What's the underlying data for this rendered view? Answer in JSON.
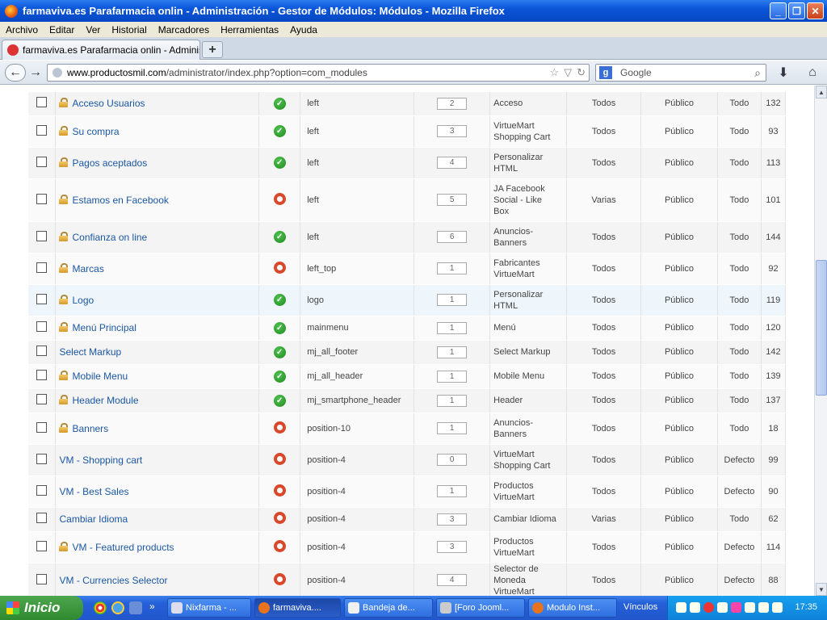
{
  "window": {
    "title": "farmaviva.es Parafarmacia onlin - Administración - Gestor de Módulos: Módulos - Mozilla Firefox",
    "minimize": "_",
    "maximize": "❐",
    "close": "✕"
  },
  "menu": [
    "Archivo",
    "Editar",
    "Ver",
    "Historial",
    "Marcadores",
    "Herramientas",
    "Ayuda"
  ],
  "tab": {
    "title": "farmaviva.es Parafarmacia onlin - Administra...",
    "new_tab": "+"
  },
  "nav": {
    "url_host": "www.productosmil.com",
    "url_path": "/administrator/index.php?option=com_modules",
    "search_placeholder": "Google",
    "search_engine": "g",
    "back": "←",
    "forward": "→",
    "star": "☆",
    "dropdown": "▽",
    "reload": "↻",
    "search_btn": "⌕",
    "download": "⬇",
    "home": "⌂"
  },
  "status_icons": {
    "published": "✓"
  },
  "modules": [
    {
      "locked": true,
      "title": "Acceso Usuarios",
      "published": true,
      "position": "left",
      "order": "2",
      "type": [
        "Acceso"
      ],
      "pages": "Todos",
      "access": "Público",
      "language": "Todo",
      "id": "132"
    },
    {
      "locked": true,
      "title": "Su compra",
      "published": true,
      "position": "left",
      "order": "3",
      "type": [
        "VirtueMart",
        "Shopping Cart"
      ],
      "pages": "Todos",
      "access": "Público",
      "language": "Todo",
      "id": "93"
    },
    {
      "locked": true,
      "title": "Pagos aceptados",
      "published": true,
      "position": "left",
      "order": "4",
      "type": [
        "Personalizar",
        "HTML"
      ],
      "pages": "Todos",
      "access": "Público",
      "language": "Todo",
      "id": "113"
    },
    {
      "locked": true,
      "title": "Estamos en Facebook",
      "published": false,
      "position": "left",
      "order": "5",
      "type": [
        "JA Facebook",
        "Social - Like",
        "Box"
      ],
      "pages": "Varias",
      "access": "Público",
      "language": "Todo",
      "id": "101"
    },
    {
      "locked": true,
      "title": "Confianza on line",
      "published": true,
      "position": "left",
      "order": "6",
      "type": [
        "Anuncios-",
        "Banners"
      ],
      "pages": "Todos",
      "access": "Público",
      "language": "Todo",
      "id": "144"
    },
    {
      "locked": true,
      "title": "Marcas",
      "published": false,
      "position": "left_top",
      "order": "1",
      "type": [
        "Fabricantes",
        "VirtueMart"
      ],
      "pages": "Todos",
      "access": "Público",
      "language": "Todo",
      "id": "92"
    },
    {
      "locked": true,
      "title": "Logo",
      "published": true,
      "position": "logo",
      "order": "1",
      "type": [
        "Personalizar",
        "HTML"
      ],
      "pages": "Todos",
      "access": "Público",
      "language": "Todo",
      "id": "119",
      "highlight": true
    },
    {
      "locked": true,
      "title": "Menú Principal",
      "published": true,
      "position": "mainmenu",
      "order": "1",
      "type": [
        "Menú"
      ],
      "pages": "Todos",
      "access": "Público",
      "language": "Todo",
      "id": "120"
    },
    {
      "locked": false,
      "title": "Select Markup",
      "published": true,
      "position": "mj_all_footer",
      "order": "1",
      "type": [
        "Select Markup"
      ],
      "pages": "Todos",
      "access": "Público",
      "language": "Todo",
      "id": "142"
    },
    {
      "locked": true,
      "title": "Mobile Menu",
      "published": true,
      "position": "mj_all_header",
      "order": "1",
      "type": [
        "Mobile Menu"
      ],
      "pages": "Todos",
      "access": "Público",
      "language": "Todo",
      "id": "139"
    },
    {
      "locked": true,
      "title": "Header Module",
      "published": true,
      "position": "mj_smartphone_header",
      "order": "1",
      "type": [
        "Header"
      ],
      "pages": "Todos",
      "access": "Público",
      "language": "Todo",
      "id": "137"
    },
    {
      "locked": true,
      "title": "Banners",
      "published": false,
      "position": "position-10",
      "order": "1",
      "type": [
        "Anuncios-",
        "Banners"
      ],
      "pages": "Todos",
      "access": "Público",
      "language": "Todo",
      "id": "18"
    },
    {
      "locked": false,
      "title": "VM - Shopping cart",
      "published": false,
      "position": "position-4",
      "order": "0",
      "type": [
        "VirtueMart",
        "Shopping Cart"
      ],
      "pages": "Todos",
      "access": "Público",
      "language": "Defecto",
      "id": "99"
    },
    {
      "locked": false,
      "title": "VM - Best Sales",
      "published": false,
      "position": "position-4",
      "order": "1",
      "type": [
        "Productos",
        "VirtueMart"
      ],
      "pages": "Todos",
      "access": "Público",
      "language": "Defecto",
      "id": "90"
    },
    {
      "locked": false,
      "title": "Cambiar Idioma",
      "published": false,
      "position": "position-4",
      "order": "3",
      "type": [
        "Cambiar Idioma"
      ],
      "pages": "Varias",
      "access": "Público",
      "language": "Todo",
      "id": "62"
    },
    {
      "locked": true,
      "title": "VM - Featured products",
      "published": false,
      "position": "position-4",
      "order": "3",
      "type": [
        "Productos",
        "VirtueMart"
      ],
      "pages": "Todos",
      "access": "Público",
      "language": "Defecto",
      "id": "114"
    },
    {
      "locked": false,
      "title": "VM - Currencies Selector",
      "published": false,
      "position": "position-4",
      "order": "4",
      "type": [
        "Selector de",
        "Moneda",
        "VirtueMart"
      ],
      "pages": "Todos",
      "access": "Público",
      "language": "Defecto",
      "id": "88"
    }
  ],
  "scrollbar": {
    "up": "▲",
    "down": "▼"
  },
  "taskbar": {
    "start_label": "Inicio",
    "overflow": "»",
    "tasks": [
      {
        "label": "Nixfarma - ...",
        "active": false
      },
      {
        "label": "farmaviva....",
        "active": true
      },
      {
        "label": "Bandeja de...",
        "active": false
      },
      {
        "label": "[Foro Jooml...",
        "active": false
      },
      {
        "label": "Modulo Inst...",
        "active": false
      }
    ],
    "links_label": "Vínculos",
    "clock": "17:35"
  }
}
